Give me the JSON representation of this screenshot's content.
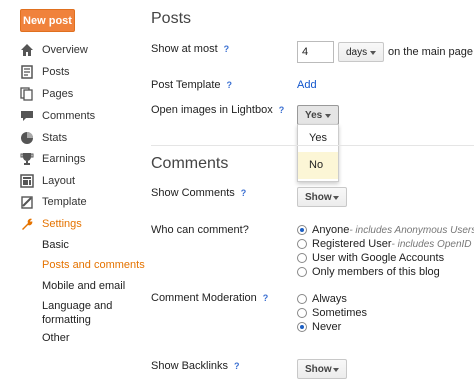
{
  "sidebar": {
    "new_post": "New post",
    "items": [
      {
        "label": "Overview",
        "icon": "home-icon"
      },
      {
        "label": "Posts",
        "icon": "posts-icon"
      },
      {
        "label": "Pages",
        "icon": "pages-icon"
      },
      {
        "label": "Comments",
        "icon": "comments-icon"
      },
      {
        "label": "Stats",
        "icon": "stats-icon"
      },
      {
        "label": "Earnings",
        "icon": "trophy-icon"
      },
      {
        "label": "Layout",
        "icon": "layout-icon"
      },
      {
        "label": "Template",
        "icon": "template-icon"
      },
      {
        "label": "Settings",
        "icon": "wrench-icon",
        "active": true
      }
    ],
    "settings_sub": [
      "Basic",
      "Posts and comments",
      "Mobile and email",
      "Language and formatting",
      "Other"
    ],
    "active_sub": "Posts and comments"
  },
  "posts_section": {
    "title": "Posts",
    "show_at_most": {
      "label": "Show at most",
      "help": "?",
      "value": "4",
      "unit": "days",
      "suffix": "on the main page"
    },
    "post_template": {
      "label": "Post Template",
      "help": "?",
      "link": "Add"
    },
    "lightbox": {
      "label": "Open images in Lightbox",
      "help": "?",
      "selected": "Yes",
      "options": [
        "Yes",
        "No"
      ],
      "hovered": "No"
    }
  },
  "comments_section": {
    "title": "Comments",
    "show_comments": {
      "label": "Show Comments",
      "help": "?",
      "value": "Show"
    },
    "who_can_comment": {
      "label": "Who can comment?",
      "help": "?",
      "options": [
        {
          "text": "Anyone",
          "note": " - includes Anonymous Users",
          "checked": true
        },
        {
          "text": "Registered User",
          "note": " - includes OpenID",
          "checked": false
        },
        {
          "text": "User with Google Accounts",
          "note": "",
          "checked": false
        },
        {
          "text": "Only members of this blog",
          "note": "",
          "checked": false
        }
      ]
    },
    "moderation": {
      "label": "Comment Moderation",
      "help": "?",
      "options": [
        {
          "text": "Always",
          "checked": false
        },
        {
          "text": "Sometimes",
          "checked": false
        },
        {
          "text": "Never",
          "checked": true
        }
      ]
    },
    "backlinks": {
      "label": "Show Backlinks",
      "help": "?",
      "value": "Show"
    }
  },
  "colors": {
    "accent": "#e57300",
    "button": "#f0823c",
    "link": "#1155cc",
    "hover": "#fcf6d6"
  }
}
